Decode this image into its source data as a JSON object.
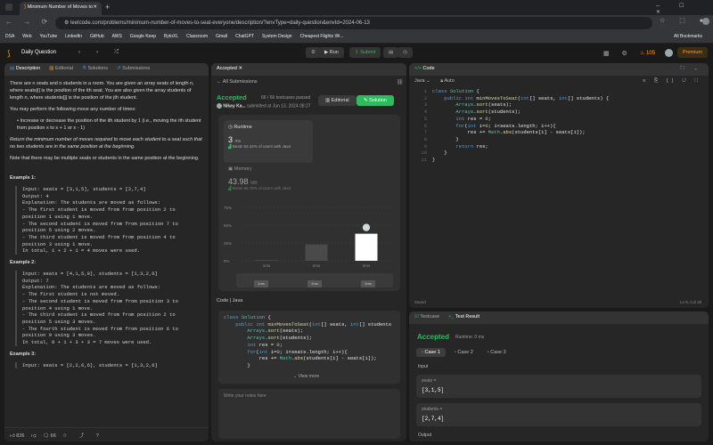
{
  "browser": {
    "tab_title": "Minimum Number of Moves to",
    "url": "leetcode.com/problems/minimum-number-of-moves-to-seat-everyone/description/?envType=daily-question&envId=2024-06-13",
    "bookmarks": [
      "DSA",
      "Web",
      "YouTube",
      "LinkedIn",
      "GitHub",
      "AWS",
      "Google Keep",
      "BytoXL",
      "Classroom",
      "Gmail",
      "ChatGPT",
      "System Design",
      "Cheapest Flights Wi..."
    ],
    "all_bookmarks": "All Bookmarks"
  },
  "nav": {
    "daily": "Daily Question",
    "run": "Run",
    "submit": "Submit",
    "streak": "105",
    "premium": "Premium"
  },
  "left": {
    "tabs": [
      "Description",
      "Editorial",
      "Solutions",
      "Submissions"
    ],
    "p1": "There are n seats and n students in a room. You are given an array seats of length n, where seats[i] is the position of the ith seat. You are also given the array students of length n, where students[j] is the position of the jth student.",
    "p2": "You may perform the following move any number of times:",
    "bullet": "Increase or decrease the position of the ith student by 1 (i.e., moving the ith student from position x to x + 1 or x - 1)",
    "p3": "Return the minimum number of moves required to move each student to a seat such that no two students are in the same position at the beginning.",
    "p4": "Note that there may be multiple seats or students in the same position at the beginning.",
    "ex1_title": "Example 1:",
    "ex1": "Input: seats = [3,1,5], students = [2,7,4]\nOutput: 4\nExplanation: The students are moved as follows:\n- The first student is moved from from position 2 to\nposition 1 using 1 move.\n- The second student is moved from from position 7 to\nposition 5 using 2 moves.\n- The third student is moved from from position 4 to\nposition 3 using 1 move.\nIn total, 1 + 2 + 1 = 4 moves were used.",
    "ex2_title": "Example 2:",
    "ex2": "Input: seats = [4,1,5,9], students = [1,3,2,6]\nOutput: 7\nExplanation: The students are moved as follows:\n- The first student is not moved.\n- The second student is moved from from position 3 to\nposition 4 using 1 move.\n- The third student is moved from from position 2 to\nposition 5 using 3 moves.\n- The fourth student is moved from from position 6 to\nposition 9 using 3 moves.\nIn total, 0 + 1 + 3 + 3 = 7 moves were used.",
    "ex3_title": "Example 3:",
    "ex3": "Input: seats = [2,2,6,6], students = [1,3,2,6]",
    "likes": "826",
    "comments": "66"
  },
  "mid": {
    "tab": "Accepted",
    "back": "All Submissions",
    "status": "Accepted",
    "passed": "66 / 66 testcases passed",
    "user": "Nikay Ka...",
    "submitted": "submitted at Jun 13, 2024 08:27",
    "editorial": "Editorial",
    "solution": "Solution",
    "runtime_label": "Runtime",
    "runtime_val": "3",
    "runtime_unit": "ms",
    "runtime_beats": "Beats 52.42% of users with Java",
    "memory_label": "Memory",
    "memory_val": "43.98",
    "memory_unit": "MB",
    "memory_beats": "Beats 85.76% of users with Java",
    "yticks": [
      "75%",
      "50%",
      "25%",
      "0%"
    ],
    "bars": [
      {
        "label": "1ms",
        "value": 1
      },
      {
        "label": "2ms",
        "value": 23
      },
      {
        "label": "3ms",
        "value": 38
      }
    ],
    "mini": [
      "1ms",
      "2ms",
      "3ms"
    ],
    "code_label": "Code",
    "lang": "Java",
    "view_more": "View more",
    "notes_placeholder": "Write your notes here"
  },
  "editor": {
    "tab": "Code",
    "lang": "Java",
    "auto": "Auto",
    "saved": "Saved",
    "cursor": "Ln 9, Col 20"
  },
  "code_lines": [
    "class Solution {",
    "    public int minMovesToSeat(int[] seats, int[] students) {",
    "        Arrays.sort(seats);",
    "        Arrays.sort(students);",
    "        int res = 0;",
    "        for(int i=0; i<seats.length; i++){",
    "            res += Math.abs(students[i] - seats[i]);",
    "        }",
    "        return res;",
    "    }",
    "}"
  ],
  "mid_code_lines": [
    "class Solution {",
    "    public int minMovesToSeat(int[] seats, int[] students",
    "        Arrays.sort(seats);",
    "        Arrays.sort(students);",
    "        int res = 0;",
    "        for(int i=0; i<seats.length; i++){",
    "            res += Math.abs(students[i] - seats[i]);",
    "        }"
  ],
  "test": {
    "tabs": [
      "Testcase",
      "Test Result"
    ],
    "status": "Accepted",
    "runtime": "Runtime: 0 ms",
    "cases": [
      "Case 1",
      "Case 2",
      "Case 3"
    ],
    "input_label": "Input",
    "seats_label": "seats =",
    "seats_val": "[3,1,5]",
    "students_label": "students =",
    "students_val": "[2,7,4]",
    "output_label": "Output"
  },
  "chart_data": {
    "type": "bar",
    "categories": [
      "1ms",
      "2ms",
      "3ms"
    ],
    "values": [
      1,
      23,
      38
    ],
    "ylim": [
      0,
      75
    ],
    "yticks": [
      "0%",
      "25%",
      "50%",
      "75%"
    ],
    "grid": true
  },
  "colors": {
    "accent_green": "#2cbb5d",
    "accepted": "#2cbb5d",
    "orange": "#ffa116"
  }
}
